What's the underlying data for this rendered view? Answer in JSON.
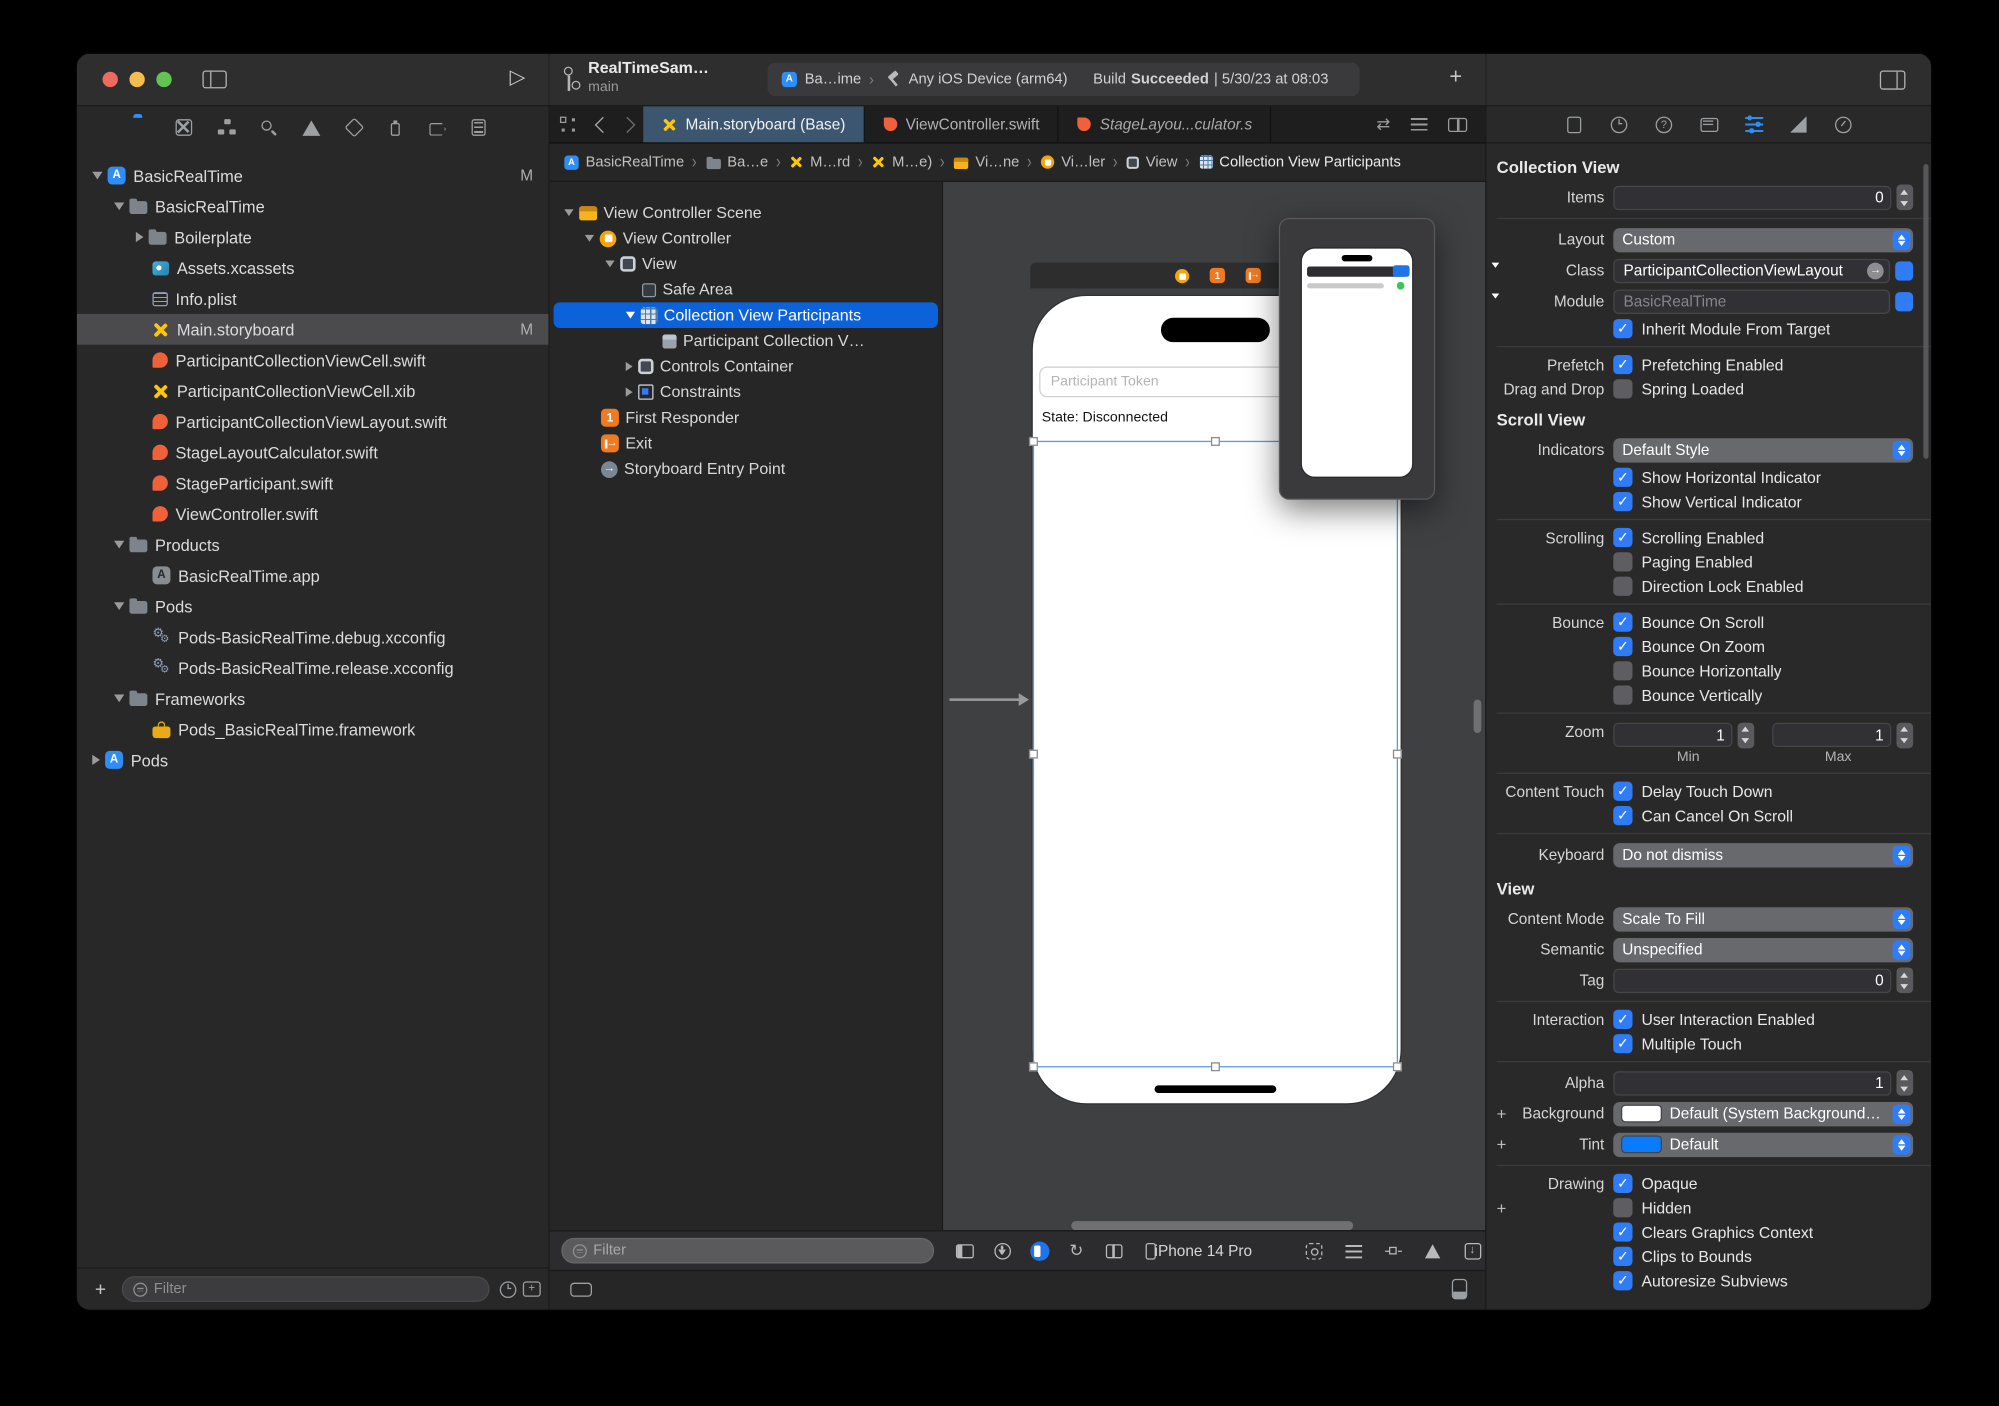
{
  "colors": {
    "accent_blue": "#2f7cf6",
    "selection_blue": "#0c62d9",
    "tab_selected_bg": "#3d566f",
    "swift_orange": "#f0603a",
    "storyboard_yellow": "#fdc609",
    "background_swatch": "#ffffff",
    "tint_swatch": "#0a7aff"
  },
  "toolbar": {
    "project": "RealTimeSam…",
    "branch": "main",
    "scheme": "Ba…ime",
    "destination": "Any iOS Device (arm64)",
    "status_prefix": "Build",
    "status_bold": "Succeeded",
    "status_suffix": "| 5/30/23 at 08:03",
    "add_label": "+"
  },
  "navigator": {
    "filter_placeholder": "Filter",
    "add_label": "+",
    "items": [
      {
        "label": "BasicRealTime",
        "icon": "app-blue",
        "depth": 0,
        "disclosure": "open",
        "badge": "M"
      },
      {
        "label": "BasicRealTime",
        "icon": "folder",
        "depth": 1,
        "disclosure": "open"
      },
      {
        "label": "Boilerplate",
        "icon": "folder",
        "depth": 2,
        "disclosure": "closed"
      },
      {
        "label": "Assets.xcassets",
        "icon": "assets",
        "depth": 2
      },
      {
        "label": "Info.plist",
        "icon": "plist",
        "depth": 2
      },
      {
        "label": "Main.storyboard",
        "icon": "storyboard",
        "depth": 2,
        "selected": true,
        "badge": "M"
      },
      {
        "label": "ParticipantCollectionViewCell.swift",
        "icon": "swift",
        "depth": 2
      },
      {
        "label": "ParticipantCollectionViewCell.xib",
        "icon": "storyboard",
        "depth": 2
      },
      {
        "label": "ParticipantCollectionViewLayout.swift",
        "icon": "swift",
        "depth": 2
      },
      {
        "label": "StageLayoutCalculator.swift",
        "icon": "swift",
        "depth": 2
      },
      {
        "label": "StageParticipant.swift",
        "icon": "swift",
        "depth": 2
      },
      {
        "label": "ViewController.swift",
        "icon": "swift",
        "depth": 2
      },
      {
        "label": "Products",
        "icon": "folder",
        "depth": 1,
        "disclosure": "open"
      },
      {
        "label": "BasicRealTime.app",
        "icon": "app-gray",
        "depth": 2
      },
      {
        "label": "Pods",
        "icon": "folder",
        "depth": 1,
        "disclosure": "open"
      },
      {
        "label": "Pods-BasicRealTime.debug.xcconfig",
        "icon": "xcconfig",
        "depth": 2
      },
      {
        "label": "Pods-BasicRealTime.release.xcconfig",
        "icon": "xcconfig",
        "depth": 2
      },
      {
        "label": "Frameworks",
        "icon": "folder",
        "depth": 1,
        "disclosure": "open"
      },
      {
        "label": "Pods_BasicRealTime.framework",
        "icon": "framework",
        "depth": 2
      },
      {
        "label": "Pods",
        "icon": "app-blue",
        "depth": 0,
        "disclosure": "closed"
      }
    ]
  },
  "tabs": {
    "items": [
      {
        "label": "Main.storyboard (Base)",
        "icon": "storyboard",
        "selected": true
      },
      {
        "label": "ViewController.swift",
        "icon": "swift",
        "selected": false
      },
      {
        "label": "StageLayou...culator.s",
        "icon": "swift",
        "selected": false,
        "italic": true
      }
    ]
  },
  "jumpbar": {
    "crumbs": [
      {
        "label": "BasicRealTime",
        "icon": "app-blue"
      },
      {
        "label": "Ba…e",
        "icon": "folder"
      },
      {
        "label": "M…rd",
        "icon": "storyboard"
      },
      {
        "label": "M…e)",
        "icon": "storyboard"
      },
      {
        "label": "Vi…ne",
        "icon": "scene"
      },
      {
        "label": "Vi…ler",
        "icon": "vc"
      },
      {
        "label": "View",
        "icon": "view"
      },
      {
        "label": "Collection View Participants",
        "icon": "collection",
        "current": true
      }
    ]
  },
  "outline": {
    "items": [
      {
        "label": "View Controller Scene",
        "icon": "scene",
        "depth": 0,
        "disclosure": "open"
      },
      {
        "label": "View Controller",
        "icon": "vc",
        "depth": 1,
        "disclosure": "open"
      },
      {
        "label": "View",
        "icon": "view",
        "depth": 2,
        "disclosure": "open"
      },
      {
        "label": "Safe Area",
        "icon": "safearea",
        "depth": 3
      },
      {
        "label": "Collection View Participants",
        "icon": "collection",
        "depth": 3,
        "disclosure": "open",
        "selected": true
      },
      {
        "label": "Participant Collection V…",
        "icon": "cube",
        "depth": 4
      },
      {
        "label": "Controls Container",
        "icon": "view",
        "depth": 3,
        "disclosure": "closed"
      },
      {
        "label": "Constraints",
        "icon": "constraints",
        "depth": 3,
        "disclosure": "closed"
      },
      {
        "label": "First Responder",
        "icon": "first-responder",
        "depth": 1
      },
      {
        "label": "Exit",
        "icon": "exit",
        "depth": 1
      },
      {
        "label": "Storyboard Entry Point",
        "icon": "entry",
        "depth": 1
      }
    ]
  },
  "canvas": {
    "phone": {
      "field_placeholder": "Participant Token",
      "state_label": "State: Disconnected"
    },
    "bottombar": {
      "filter_placeholder": "Filter",
      "device_name": "iPhone 14 Pro"
    }
  },
  "inspector": {
    "rows": [
      {
        "type": "header",
        "text": "Collection View"
      },
      {
        "type": "field",
        "label": "Items",
        "value": "0"
      },
      {
        "type": "sep"
      },
      {
        "type": "popup",
        "label": "Layout",
        "value": "Custom"
      },
      {
        "type": "combo",
        "label": "Class",
        "value": "ParticipantCollectionViewLayout"
      },
      {
        "type": "popup-field",
        "label": "Module",
        "value": "BasicRealTime",
        "muted": true
      },
      {
        "type": "check",
        "label": "",
        "text": "Inherit Module From Target",
        "checked": true
      },
      {
        "type": "sep"
      },
      {
        "type": "check",
        "label": "Prefetch",
        "text": "Prefetching Enabled",
        "checked": true
      },
      {
        "type": "check",
        "label": "Drag and Drop",
        "text": "Spring Loaded",
        "checked": false
      },
      {
        "type": "header",
        "text": "Scroll View"
      },
      {
        "type": "popup",
        "label": "Indicators",
        "value": "Default Style"
      },
      {
        "type": "check",
        "label": "",
        "text": "Show Horizontal Indicator",
        "checked": true
      },
      {
        "type": "check",
        "label": "",
        "text": "Show Vertical Indicator",
        "checked": true
      },
      {
        "type": "sep"
      },
      {
        "type": "check",
        "label": "Scrolling",
        "text": "Scrolling Enabled",
        "checked": true
      },
      {
        "type": "check",
        "label": "",
        "text": "Paging Enabled",
        "checked": false
      },
      {
        "type": "check",
        "label": "",
        "text": "Direction Lock Enabled",
        "checked": false
      },
      {
        "type": "sep"
      },
      {
        "type": "check",
        "label": "Bounce",
        "text": "Bounce On Scroll",
        "checked": true
      },
      {
        "type": "check",
        "label": "",
        "text": "Bounce On Zoom",
        "checked": true
      },
      {
        "type": "check",
        "label": "",
        "text": "Bounce Horizontally",
        "checked": false
      },
      {
        "type": "check",
        "label": "",
        "text": "Bounce Vertically",
        "checked": false
      },
      {
        "type": "sep"
      },
      {
        "type": "zoom",
        "label": "Zoom",
        "min_value": "1",
        "max_value": "1",
        "min_label": "Min",
        "max_label": "Max"
      },
      {
        "type": "sep"
      },
      {
        "type": "check",
        "label": "Content Touch",
        "text": "Delay Touch Down",
        "checked": true
      },
      {
        "type": "check",
        "label": "",
        "text": "Can Cancel On Scroll",
        "checked": true
      },
      {
        "type": "sep"
      },
      {
        "type": "popup",
        "label": "Keyboard",
        "value": "Do not dismiss"
      },
      {
        "type": "header",
        "text": "View"
      },
      {
        "type": "popup",
        "label": "Content Mode",
        "value": "Scale To Fill"
      },
      {
        "type": "popup",
        "label": "Semantic",
        "value": "Unspecified"
      },
      {
        "type": "field",
        "label": "Tag",
        "value": "0"
      },
      {
        "type": "sep"
      },
      {
        "type": "check",
        "label": "Interaction",
        "text": "User Interaction Enabled",
        "checked": true
      },
      {
        "type": "check",
        "label": "",
        "text": "Multiple Touch",
        "checked": true
      },
      {
        "type": "sep"
      },
      {
        "type": "field",
        "label": "Alpha",
        "value": "1"
      },
      {
        "type": "color",
        "label": "Background",
        "value": "Default (System Background…",
        "swatch": "#ffffff",
        "plus": true
      },
      {
        "type": "color",
        "label": "Tint",
        "value": "Default",
        "swatch": "#0a7aff",
        "plus": true
      },
      {
        "type": "sep"
      },
      {
        "type": "check",
        "label": "Drawing",
        "text": "Opaque",
        "checked": true
      },
      {
        "type": "check",
        "label": "",
        "text": "Hidden",
        "checked": false,
        "plus": true
      },
      {
        "type": "check",
        "label": "",
        "text": "Clears Graphics Context",
        "checked": true
      },
      {
        "type": "check",
        "label": "",
        "text": "Clips to Bounds",
        "checked": true
      },
      {
        "type": "check",
        "label": "",
        "text": "Autoresize Subviews",
        "checked": true
      }
    ]
  }
}
